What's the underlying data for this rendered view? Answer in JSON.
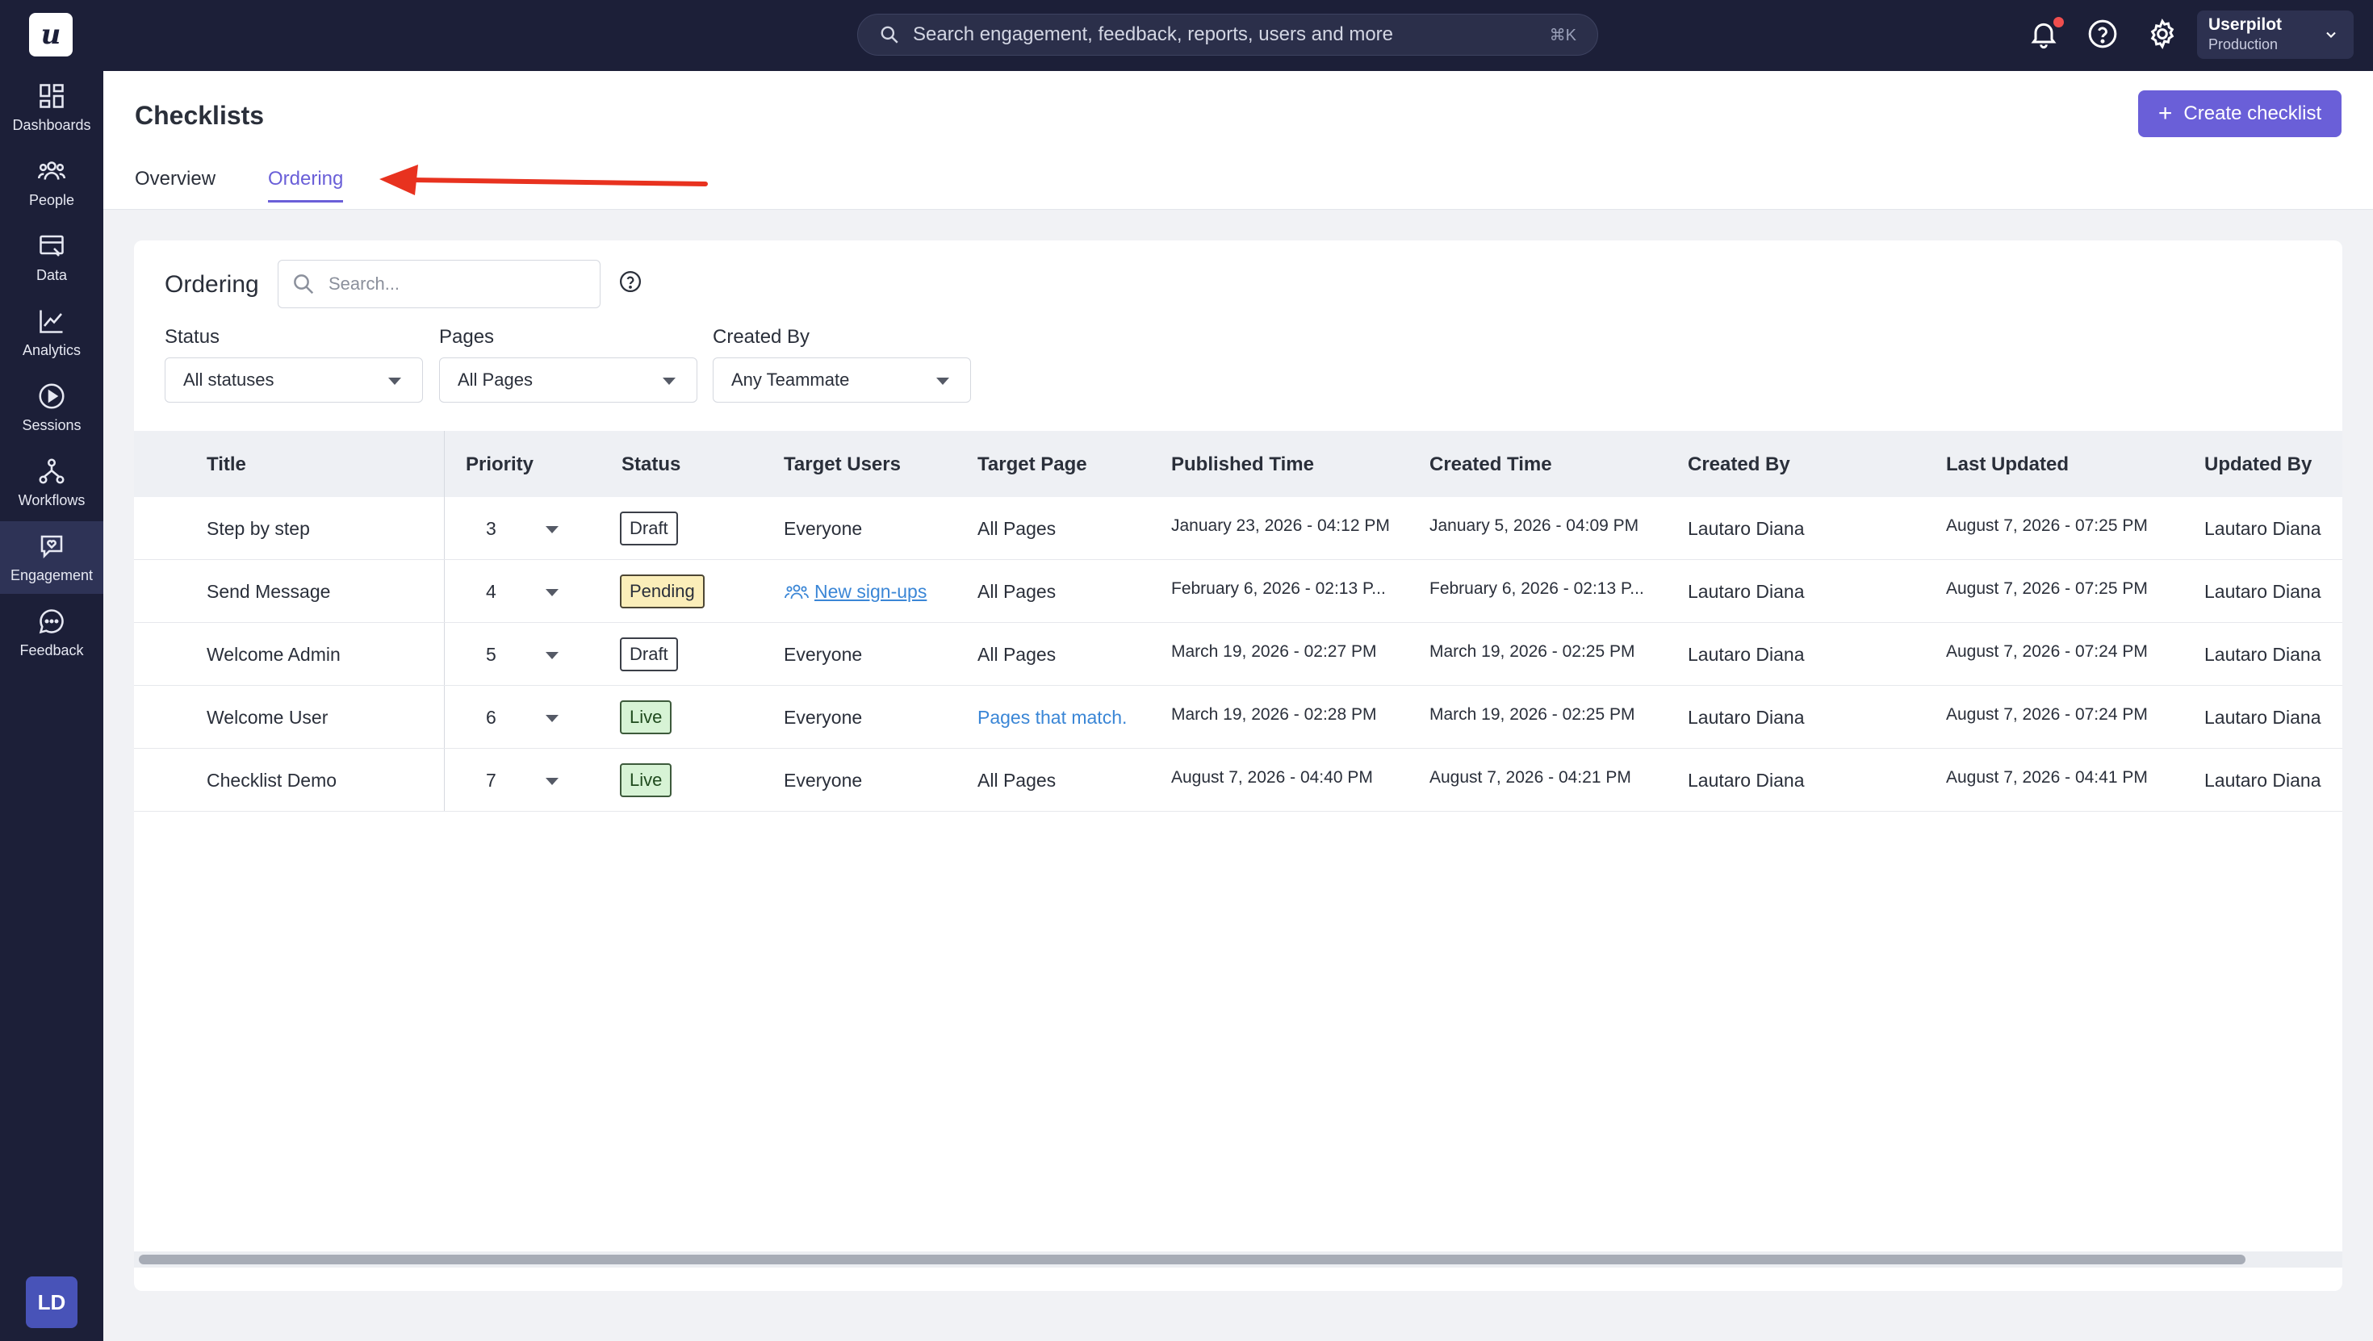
{
  "app": {
    "logo_letter": "u",
    "search_placeholder": "Search engagement, feedback, reports, users and more",
    "search_shortcut": "⌘K",
    "account_name": "Userpilot",
    "account_env": "Production",
    "user_initials": "LD"
  },
  "sidebar": {
    "items": [
      {
        "label": "Dashboards",
        "icon": "dashboards-icon"
      },
      {
        "label": "People",
        "icon": "people-icon"
      },
      {
        "label": "Data",
        "icon": "data-icon"
      },
      {
        "label": "Analytics",
        "icon": "analytics-icon"
      },
      {
        "label": "Sessions",
        "icon": "sessions-icon"
      },
      {
        "label": "Workflows",
        "icon": "workflows-icon"
      },
      {
        "label": "Engagement",
        "icon": "engagement-icon",
        "active": true
      },
      {
        "label": "Feedback",
        "icon": "feedback-icon"
      }
    ]
  },
  "header": {
    "title": "Checklists",
    "create_label": "Create checklist",
    "tabs": [
      {
        "label": "Overview",
        "active": false
      },
      {
        "label": "Ordering",
        "active": true
      }
    ]
  },
  "panel": {
    "title": "Ordering",
    "search_placeholder": "Search...",
    "filters": [
      {
        "label": "Status",
        "value": "All statuses"
      },
      {
        "label": "Pages",
        "value": "All Pages"
      },
      {
        "label": "Created By",
        "value": "Any Teammate"
      }
    ]
  },
  "table": {
    "columns": [
      "Title",
      "Priority",
      "Status",
      "Target Users",
      "Target Page",
      "Published Time",
      "Created Time",
      "Created By",
      "Last Updated",
      "Updated By"
    ],
    "rows": [
      {
        "title": "Step by step",
        "priority": "3",
        "status": "Draft",
        "target_users": "Everyone",
        "target_page": "All Pages",
        "published": "January 23, 2026 - 04:12 PM",
        "created": "January 5, 2026 - 04:09 PM",
        "created_by": "Lautaro Diana",
        "last_updated": "August 7, 2026 - 07:25 PM",
        "updated_by": "Lautaro Diana"
      },
      {
        "title": "Send Message",
        "priority": "4",
        "status": "Pending",
        "target_users": "New sign-ups",
        "target_page": "All Pages",
        "published": "February 6, 2026 - 02:13 P...",
        "created": "February 6, 2026 - 02:13 P...",
        "created_by": "Lautaro Diana",
        "last_updated": "August 7, 2026 - 07:25 PM",
        "updated_by": "Lautaro Diana"
      },
      {
        "title": "Welcome Admin",
        "priority": "5",
        "status": "Draft",
        "target_users": "Everyone",
        "target_page": "All Pages",
        "published": "March 19, 2026 - 02:27 PM",
        "created": "March 19, 2026 - 02:25 PM",
        "created_by": "Lautaro Diana",
        "last_updated": "August 7, 2026 - 07:24 PM",
        "updated_by": "Lautaro Diana"
      },
      {
        "title": "Welcome User",
        "priority": "6",
        "status": "Live",
        "target_users": "Everyone",
        "target_page": "Pages that match.",
        "published": "March 19, 2026 - 02:28 PM",
        "created": "March 19, 2026 - 02:25 PM",
        "created_by": "Lautaro Diana",
        "last_updated": "August 7, 2026 - 07:24 PM",
        "updated_by": "Lautaro Diana"
      },
      {
        "title": "Checklist Demo",
        "priority": "7",
        "status": "Live",
        "target_users": "Everyone",
        "target_page": "All Pages",
        "published": "August 7, 2026 - 04:40 PM",
        "created": "August 7, 2026 - 04:21 PM",
        "created_by": "Lautaro Diana",
        "last_updated": "August 7, 2026 - 04:41 PM",
        "updated_by": "Lautaro Diana"
      }
    ]
  },
  "colors": {
    "nav_bg": "#1c1f38",
    "accent": "#6a5fd8",
    "annotation_arrow": "#e8321f",
    "link": "#3a86d6"
  }
}
